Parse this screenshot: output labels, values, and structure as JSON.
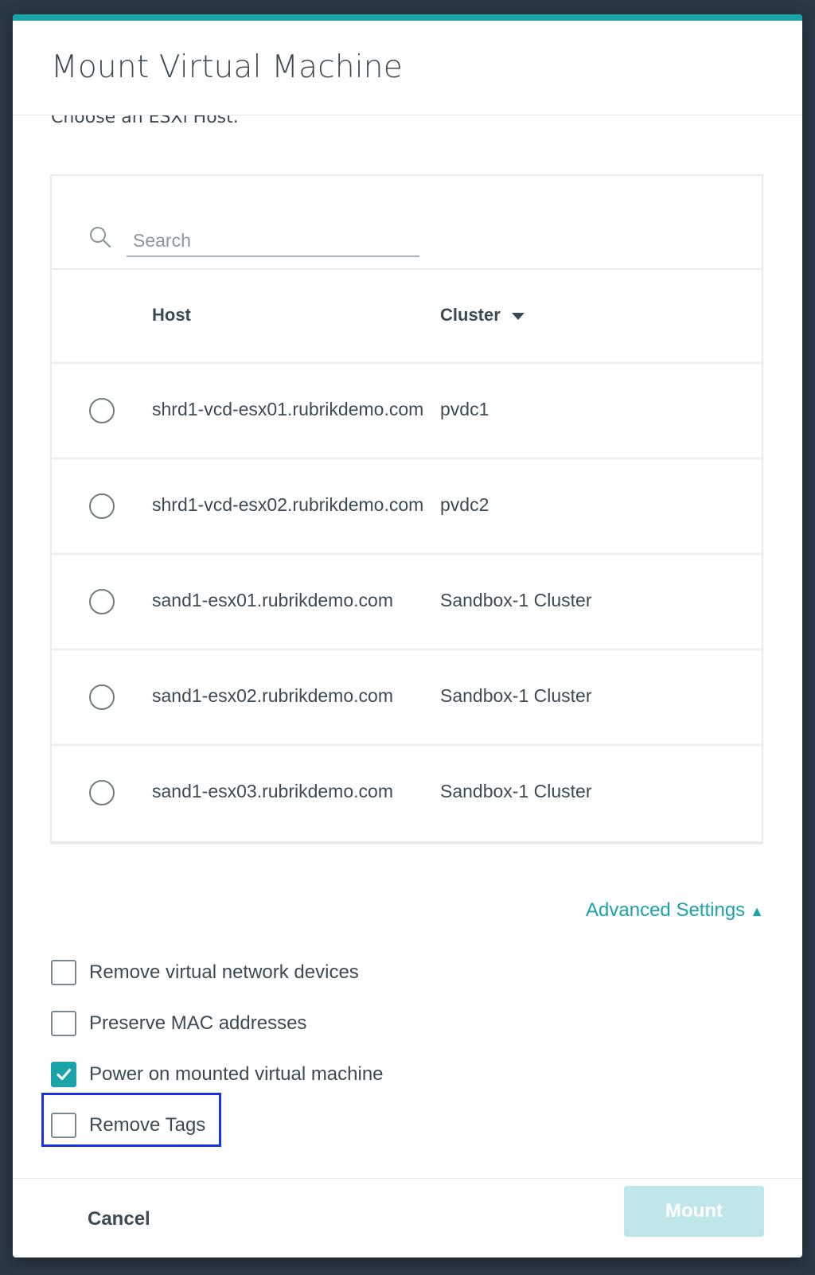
{
  "dialog": {
    "title": "Mount Virtual Machine",
    "subtitle": "Choose an ESXi Host."
  },
  "search": {
    "placeholder": "Search",
    "value": ""
  },
  "table": {
    "columns": {
      "host": "Host",
      "cluster": "Cluster"
    },
    "rows": [
      {
        "host": "shrd1-vcd-esx01.rubrikdemo.com",
        "cluster": "pvdc1",
        "selected": false
      },
      {
        "host": "shrd1-vcd-esx02.rubrikdemo.com",
        "cluster": "pvdc2",
        "selected": false
      },
      {
        "host": "sand1-esx01.rubrikdemo.com",
        "cluster": "Sandbox-1 Cluster",
        "selected": false
      },
      {
        "host": "sand1-esx02.rubrikdemo.com",
        "cluster": "Sandbox-1 Cluster",
        "selected": false
      },
      {
        "host": "sand1-esx03.rubrikdemo.com",
        "cluster": "Sandbox-1 Cluster",
        "selected": false
      }
    ]
  },
  "advanced": {
    "label": "Advanced Settings",
    "caret": "▲",
    "options": [
      {
        "label": "Remove virtual network devices",
        "checked": false
      },
      {
        "label": "Preserve MAC addresses",
        "checked": false
      },
      {
        "label": "Power on mounted virtual machine",
        "checked": true
      },
      {
        "label": "Remove Tags",
        "checked": false
      }
    ]
  },
  "footer": {
    "cancel_label": "Cancel",
    "mount_label": "Mount"
  },
  "colors": {
    "accent": "#1aa3a9",
    "highlight": "#1a2fe8",
    "mount_disabled": "#bfe7e9"
  },
  "icons": {
    "search": "search-icon",
    "checkmark": "checkmark-icon",
    "sort": "caret-down-icon"
  }
}
